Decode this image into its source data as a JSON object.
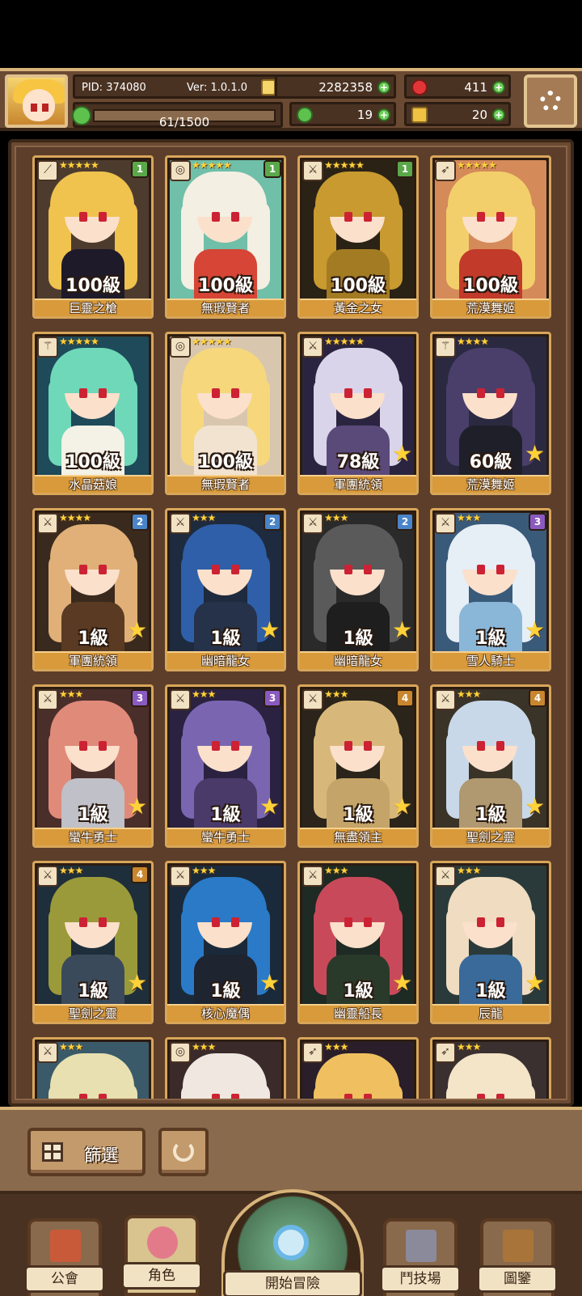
{
  "header": {
    "pid": "PID: 374080",
    "version": "Ver: 1.0.1.0",
    "exp": "61/1500",
    "gold": "2282358",
    "gems": "411",
    "clovers": "19",
    "keys": "20"
  },
  "cards": [
    {
      "name": "巨靈之槍",
      "level": "100級",
      "stars": "★★★★★",
      "badge": "1",
      "badge_color": "#5aa84a",
      "weapon": "spear",
      "palette": {
        "bg": "#4d3c2e",
        "hair": "#f0c24e",
        "body": "#1e1a2a"
      },
      "upgrade": false
    },
    {
      "name": "無瑕賢者",
      "level": "100級",
      "stars": "★★★★★",
      "badge": "1",
      "badge_color": "#5aa84a",
      "weapon": "orb",
      "palette": {
        "bg": "#6fbfa9",
        "hair": "#f3efe2",
        "body": "#d64535"
      },
      "upgrade": false
    },
    {
      "name": "黃金之女",
      "level": "100級",
      "stars": "★★★★★",
      "badge": "1",
      "badge_color": "#5aa84a",
      "weapon": "sword",
      "palette": {
        "bg": "#2b2216",
        "hair": "#c89a2f",
        "body": "#a37b22"
      },
      "upgrade": false
    },
    {
      "name": "荒漠舞姬",
      "level": "100級",
      "stars": "★★★★★",
      "badge": "",
      "badge_color": "",
      "weapon": "bow",
      "palette": {
        "bg": "#d58a5a",
        "hair": "#f2cf6a",
        "body": "#c23a2a"
      },
      "upgrade": false
    },
    {
      "name": "水晶菇娘",
      "level": "100級",
      "stars": "★★★★★",
      "badge": "",
      "badge_color": "",
      "weapon": "staff",
      "palette": {
        "bg": "#1e4a5a",
        "hair": "#6ed8b8",
        "body": "#f4f1e6"
      },
      "upgrade": false
    },
    {
      "name": "無瑕賢者",
      "level": "100級",
      "stars": "★★★★★",
      "badge": "",
      "badge_color": "",
      "weapon": "orb",
      "palette": {
        "bg": "#d8c7ae",
        "hair": "#f6d77c",
        "body": "#f1e3cf"
      },
      "upgrade": false
    },
    {
      "name": "軍團統領",
      "level": "78級",
      "stars": "★★★★★",
      "badge": "",
      "badge_color": "",
      "weapon": "sword",
      "palette": {
        "bg": "#2b2440",
        "hair": "#d9d4ea",
        "body": "#5a4a7a"
      },
      "upgrade": true
    },
    {
      "name": "荒漠舞姬",
      "level": "60級",
      "stars": "★★★★",
      "badge": "",
      "badge_color": "",
      "weapon": "staff",
      "palette": {
        "bg": "#2a2940",
        "hair": "#4a3f6a",
        "body": "#1f1f2a"
      },
      "upgrade": true
    },
    {
      "name": "軍團統領",
      "level": "1級",
      "stars": "★★★★",
      "badge": "2",
      "badge_color": "#4a84c8",
      "weapon": "sword",
      "palette": {
        "bg": "#3a2a1e",
        "hair": "#e0b078",
        "body": "#5a3a22"
      },
      "upgrade": true
    },
    {
      "name": "幽暗龍女",
      "level": "1級",
      "stars": "★★★",
      "badge": "2",
      "badge_color": "#4a84c8",
      "weapon": "sword",
      "palette": {
        "bg": "#1e2a3e",
        "hair": "#2f5fa8",
        "body": "#26324a"
      },
      "upgrade": true
    },
    {
      "name": "幽暗龍女",
      "level": "1級",
      "stars": "★★★",
      "badge": "2",
      "badge_color": "#4a84c8",
      "weapon": "sword",
      "palette": {
        "bg": "#2a2a2a",
        "hair": "#5a5a5a",
        "body": "#1e1e1e"
      },
      "upgrade": true
    },
    {
      "name": "雪人騎士",
      "level": "1級",
      "stars": "★★★",
      "badge": "3",
      "badge_color": "#8a5ac0",
      "weapon": "sword",
      "palette": {
        "bg": "#3a5a7a",
        "hair": "#e6eef6",
        "body": "#8ab6d8"
      },
      "upgrade": true
    },
    {
      "name": "蠻牛勇士",
      "level": "1級",
      "stars": "★★★",
      "badge": "3",
      "badge_color": "#8a5ac0",
      "weapon": "sword",
      "palette": {
        "bg": "#4a2e2a",
        "hair": "#e08a7a",
        "body": "#c0c0c8"
      },
      "upgrade": true
    },
    {
      "name": "蠻牛勇士",
      "level": "1級",
      "stars": "★★★",
      "badge": "3",
      "badge_color": "#8a5ac0",
      "weapon": "sword",
      "palette": {
        "bg": "#2a2240",
        "hair": "#7a66b0",
        "body": "#4a3a6a"
      },
      "upgrade": true
    },
    {
      "name": "無盡領主",
      "level": "1級",
      "stars": "★★★",
      "badge": "4",
      "badge_color": "#c8862e",
      "weapon": "sword",
      "palette": {
        "bg": "#2a241a",
        "hair": "#d8b87a",
        "body": "#c4a468"
      },
      "upgrade": true
    },
    {
      "name": "聖劍之靈",
      "level": "1級",
      "stars": "★★★",
      "badge": "4",
      "badge_color": "#c8862e",
      "weapon": "sword",
      "palette": {
        "bg": "#3a3328",
        "hair": "#c8d8e8",
        "body": "#b09870"
      },
      "upgrade": true
    },
    {
      "name": "聖劍之靈",
      "level": "1級",
      "stars": "★★★",
      "badge": "4",
      "badge_color": "#c8862e",
      "weapon": "sword",
      "palette": {
        "bg": "#1e2e3a",
        "hair": "#9a9a3a",
        "body": "#3a4a5a"
      },
      "upgrade": true
    },
    {
      "name": "核心魔偶",
      "level": "1級",
      "stars": "★★★",
      "badge": "",
      "badge_color": "",
      "weapon": "sword",
      "palette": {
        "bg": "#1a2a3a",
        "hair": "#2a7ac8",
        "body": "#1e2430"
      },
      "upgrade": true
    },
    {
      "name": "幽靈船長",
      "level": "1級",
      "stars": "★★★",
      "badge": "",
      "badge_color": "",
      "weapon": "sword",
      "palette": {
        "bg": "#1e2a24",
        "hair": "#c84a5a",
        "body": "#2a3a2a"
      },
      "upgrade": true
    },
    {
      "name": "辰龍",
      "level": "1級",
      "stars": "★★★",
      "badge": "",
      "badge_color": "",
      "weapon": "sword",
      "palette": {
        "bg": "#2a3a3a",
        "hair": "#f0dcc0",
        "body": "#3a6a9a"
      },
      "upgrade": true
    },
    {
      "name": "",
      "level": "",
      "stars": "★★★",
      "badge": "",
      "badge_color": "",
      "weapon": "sword",
      "palette": {
        "bg": "#3a5a6a",
        "hair": "#e8e0b0",
        "body": "#5a8aa8"
      },
      "upgrade": false
    },
    {
      "name": "",
      "level": "",
      "stars": "★★★",
      "badge": "",
      "badge_color": "",
      "weapon": "orb",
      "palette": {
        "bg": "#3a2a2a",
        "hair": "#f0e8e0",
        "body": "#8a4a3a"
      },
      "upgrade": false
    },
    {
      "name": "",
      "level": "",
      "stars": "★★★",
      "badge": "",
      "badge_color": "",
      "weapon": "bow",
      "palette": {
        "bg": "#2a1e2a",
        "hair": "#f0c060",
        "body": "#b82a3a"
      },
      "upgrade": false
    },
    {
      "name": "",
      "level": "",
      "stars": "★★★",
      "badge": "",
      "badge_color": "",
      "weapon": "bow",
      "palette": {
        "bg": "#3a3030",
        "hair": "#f4e4c8",
        "body": "#6a5a4a"
      },
      "upgrade": false
    }
  ],
  "filter": {
    "filter_label": "篩選"
  },
  "nav": {
    "guild": "公會",
    "characters": "角色",
    "adventure": "開始冒險",
    "arena": "鬥技場",
    "codex": "圖鑒"
  },
  "colors": {
    "frame": "#6a4a33",
    "card_border": "#d8a65a",
    "name_plate": "#d89a3a",
    "upgrade_arrow": "#5ed14a",
    "star": "#ffd23a"
  }
}
